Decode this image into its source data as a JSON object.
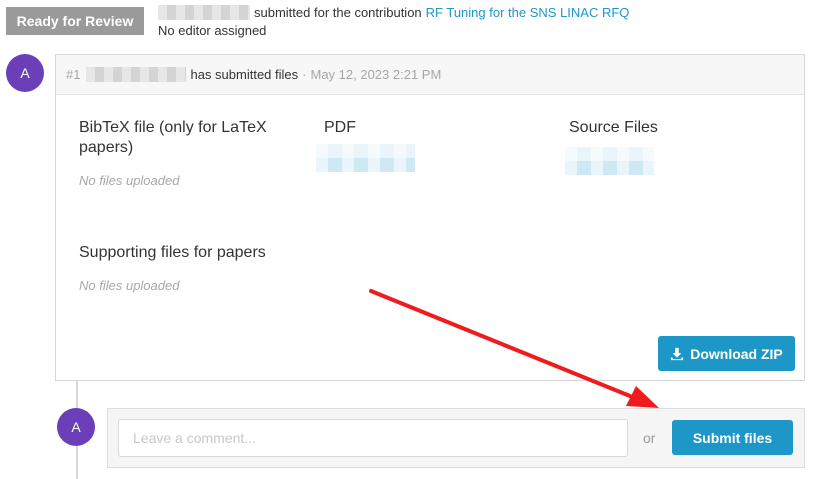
{
  "header": {
    "status_badge": "Ready for Review",
    "submitted_prefix": "A",
    "submitted_text": "submitted for the contribution",
    "contribution_link": "RF Tuning for the SNS LINAC RFQ",
    "no_editor": "No editor assigned"
  },
  "revision": {
    "avatar_letter": "A",
    "number": "#1",
    "action": "has submitted files",
    "separator": "·",
    "date": "May 12, 2023 2:21 PM",
    "file_types": [
      {
        "title": "BibTeX file (only for LaTeX papers)",
        "empty_text": "No files uploaded"
      },
      {
        "title": "PDF"
      },
      {
        "title": "Source Files"
      },
      {
        "title": "Supporting files for papers",
        "empty_text": "No files uploaded"
      }
    ],
    "download_label": "Download ZIP",
    "download_icon": "download-icon"
  },
  "comment": {
    "avatar_letter": "A",
    "placeholder": "Leave a comment...",
    "or_text": "or",
    "submit_label": "Submit files"
  },
  "colors": {
    "accent": "#1d97c8",
    "badge_bg": "#9a9a9a",
    "avatar_bg": "#6a3fb8",
    "arrow": "#ee1c1c"
  }
}
